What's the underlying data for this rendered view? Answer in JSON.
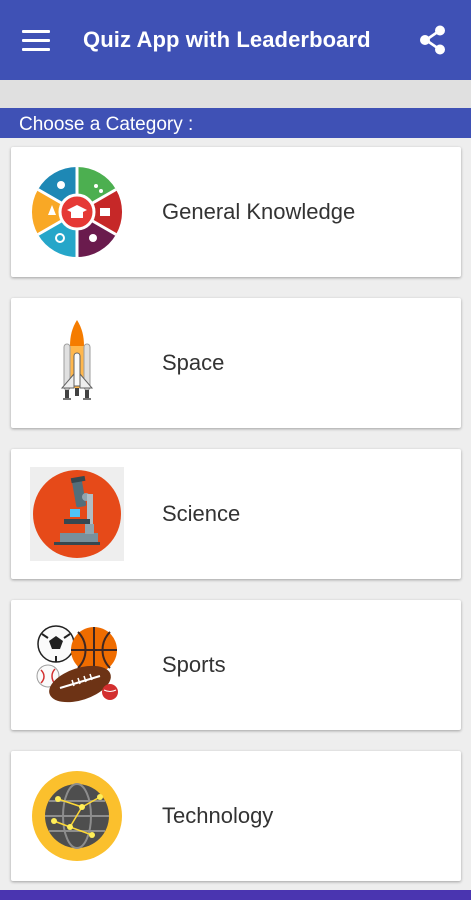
{
  "appbar": {
    "title": "Quiz App with Leaderboard",
    "menu_icon": "hamburger-menu-icon",
    "share_icon": "share-icon",
    "color": "#3f51b5"
  },
  "section": {
    "header": "Choose a Category :"
  },
  "categories": [
    {
      "label": "General Knowledge",
      "icon": "general-knowledge-icon"
    },
    {
      "label": "Space",
      "icon": "space-shuttle-icon"
    },
    {
      "label": "Science",
      "icon": "microscope-icon"
    },
    {
      "label": "Sports",
      "icon": "sports-balls-icon"
    },
    {
      "label": "Technology",
      "icon": "globe-network-icon"
    }
  ]
}
